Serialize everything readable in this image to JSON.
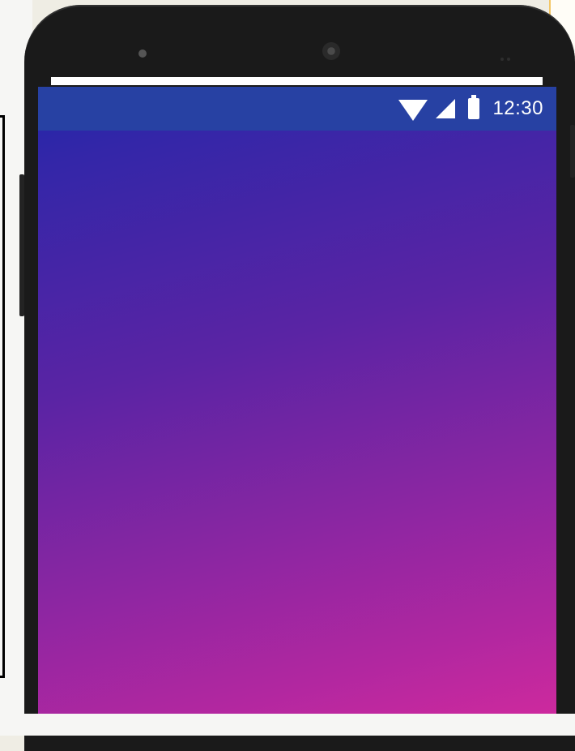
{
  "status_bar": {
    "time": "12:30",
    "icons": [
      "wifi-icon",
      "signal-icon",
      "battery-icon"
    ]
  },
  "screen": {
    "background_gradient": [
      "#2126a7",
      "#5a24a4",
      "#b227a0",
      "#d32a9d"
    ]
  },
  "colors": {
    "status_bar_bg": "#2741a3",
    "phone_body": "#1a1a1a"
  }
}
